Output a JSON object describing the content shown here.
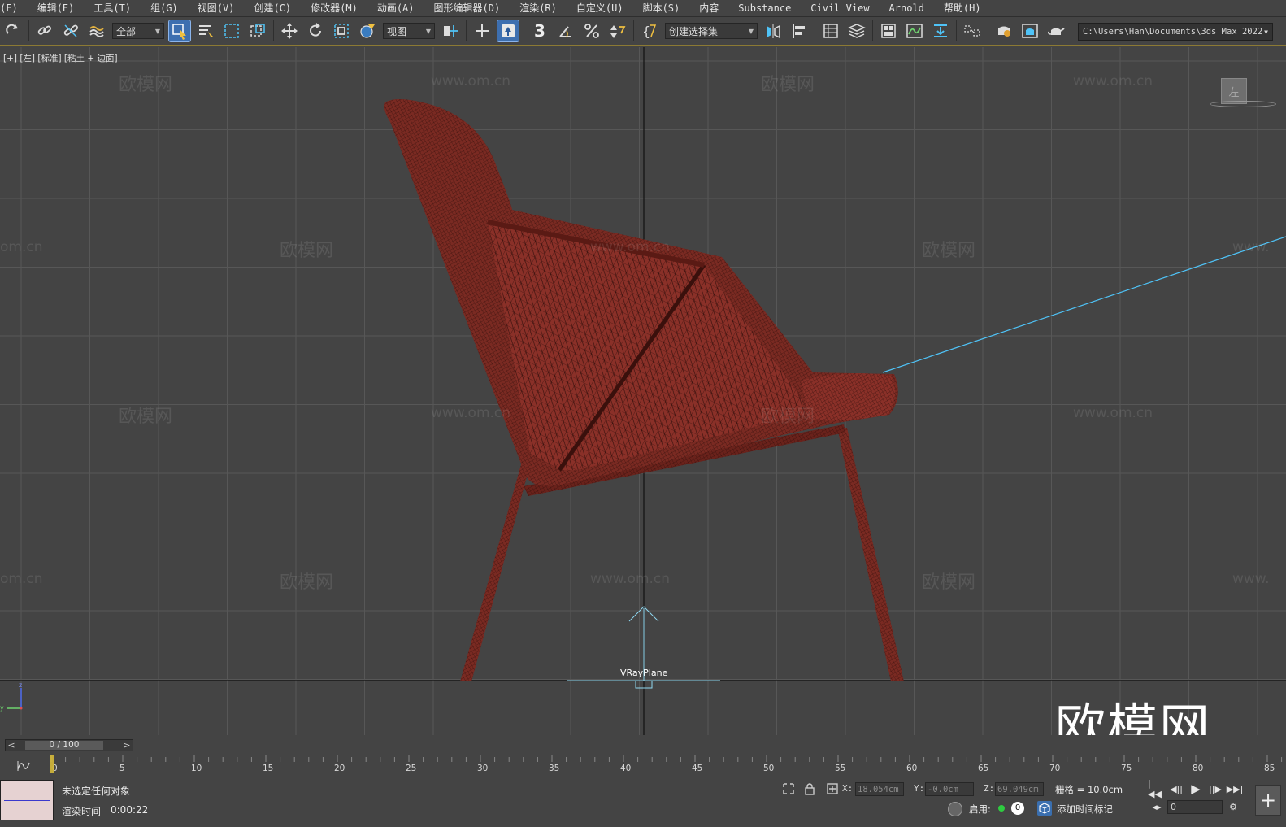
{
  "menu": {
    "items": [
      {
        "label": "(F)",
        "name": "menu-file"
      },
      {
        "label": "编辑(E)",
        "name": "menu-edit"
      },
      {
        "label": "工具(T)",
        "name": "menu-tools"
      },
      {
        "label": "组(G)",
        "name": "menu-group"
      },
      {
        "label": "视图(V)",
        "name": "menu-views"
      },
      {
        "label": "创建(C)",
        "name": "menu-create"
      },
      {
        "label": "修改器(M)",
        "name": "menu-modifiers"
      },
      {
        "label": "动画(A)",
        "name": "menu-animation"
      },
      {
        "label": "图形编辑器(D)",
        "name": "menu-graph-editors"
      },
      {
        "label": "渲染(R)",
        "name": "menu-rendering"
      },
      {
        "label": "自定义(U)",
        "name": "menu-customize"
      },
      {
        "label": "脚本(S)",
        "name": "menu-scripting"
      },
      {
        "label": "内容",
        "name": "menu-content"
      },
      {
        "label": "Substance",
        "name": "menu-substance"
      },
      {
        "label": "Civil View",
        "name": "menu-civil-view"
      },
      {
        "label": "Arnold",
        "name": "menu-arnold"
      },
      {
        "label": "帮助(H)",
        "name": "menu-help"
      }
    ]
  },
  "toolbar": {
    "filter_value": "全部",
    "ref_coord_value": "视图",
    "named_selection_value": "创建选择集",
    "project_path": "C:\\Users\\Han\\Documents\\3ds Max 2022",
    "snap_label": "3"
  },
  "viewport": {
    "label": "[+] [左] [标准] [粘土 + 边面]",
    "object_label": "VRayPlane",
    "view_cube_label": "左",
    "watermark_cn": "欧模网",
    "watermark_url": "www.om.cn",
    "watermark_url_partial": "om.cn",
    "watermark_url_partial_right": "www.",
    "logo_text": "欧模网",
    "axis_z": "z",
    "axis_y": "y"
  },
  "timeline": {
    "slider_text": "0 / 100",
    "current_frame": 0,
    "total_frames": 100,
    "tick_labels": [
      "0",
      "5",
      "10",
      "15",
      "20",
      "25",
      "30",
      "35",
      "40",
      "45",
      "50",
      "55",
      "60",
      "65",
      "70",
      "75",
      "80",
      "85"
    ]
  },
  "status": {
    "selection_text": "未选定任何对象",
    "render_time_label": "渲染时间",
    "render_time_value": "0:00:22",
    "x_label": "X:",
    "x_value": "18.054cm",
    "y_label": "Y:",
    "y_value": "-0.0cm",
    "z_label": "Z:",
    "z_value": "69.049cm",
    "grid_text": "栅格 = 10.0cm",
    "enable_label": "启用:",
    "enable_count": "0",
    "add_time_tag": "添加时间标记",
    "frame_value": "0"
  },
  "colors": {
    "background": "#444444",
    "chair": "#7a2a22",
    "wire": "#2a0c09",
    "light_line": "#4fc3f7",
    "accent": "#8c7a34"
  }
}
